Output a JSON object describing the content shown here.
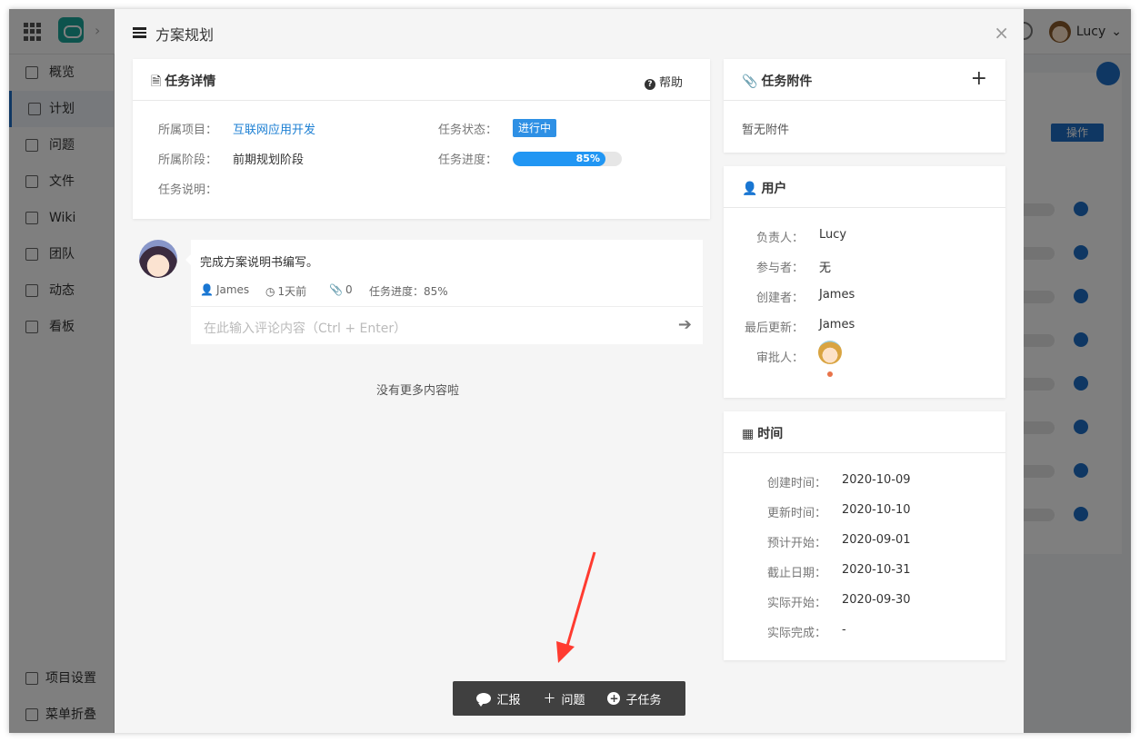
{
  "topbar": {
    "user_name": "Lucy"
  },
  "sidebar": {
    "items": [
      {
        "label": "概览"
      },
      {
        "label": "计划"
      },
      {
        "label": "问题"
      },
      {
        "label": "文件"
      },
      {
        "label": "Wiki"
      },
      {
        "label": "团队"
      },
      {
        "label": "动态"
      },
      {
        "label": "看板"
      }
    ],
    "bottom": [
      {
        "label": "项目设置"
      },
      {
        "label": "菜单折叠"
      }
    ]
  },
  "background": {
    "ops_button": "操作"
  },
  "modal": {
    "title": "方案规划",
    "close": "×",
    "detail": {
      "title": "任务详情",
      "help": "帮助",
      "project_label": "所属项目：",
      "project_value": "互联网应用开发",
      "stage_label": "所属阶段：",
      "stage_value": "前期规划阶段",
      "desc_label": "任务说明：",
      "status_label": "任务状态：",
      "status_value": "进行中",
      "progress_label": "任务进度：",
      "progress_value": "85%",
      "progress_fraction": 0.85
    },
    "comment": {
      "text": "完成方案说明书编写。",
      "author": "James",
      "time": "1天前",
      "attachments": "0",
      "progress": "任务进度：85%",
      "input_placeholder": "在此输入评论内容（Ctrl + Enter）"
    },
    "no_more": "没有更多内容啦",
    "attachments": {
      "title": "任务附件",
      "empty": "暂无附件"
    },
    "users": {
      "title": "用户",
      "owner_label": "负责人：",
      "owner": "Lucy",
      "participants_label": "参与者：",
      "participants": "无",
      "creator_label": "创建者：",
      "creator": "James",
      "updater_label": "最后更新：",
      "updater": "James",
      "approver_label": "审批人："
    },
    "time": {
      "title": "时间",
      "created_label": "创建时间：",
      "created": "2020-10-09",
      "updated_label": "更新时间：",
      "updated": "2020-10-10",
      "plan_start_label": "预计开始：",
      "plan_start": "2020-09-01",
      "deadline_label": "截止日期：",
      "deadline": "2020-10-31",
      "actual_start_label": "实际开始：",
      "actual_start": "2020-09-30",
      "actual_done_label": "实际完成：",
      "actual_done": "-"
    },
    "actions": {
      "report": "汇报",
      "issue": "问题",
      "subtask": "子任务"
    }
  },
  "colors": {
    "accent": "#2196f3",
    "link": "#1c7fd3",
    "annotation_arrow": "#ff3b30"
  }
}
